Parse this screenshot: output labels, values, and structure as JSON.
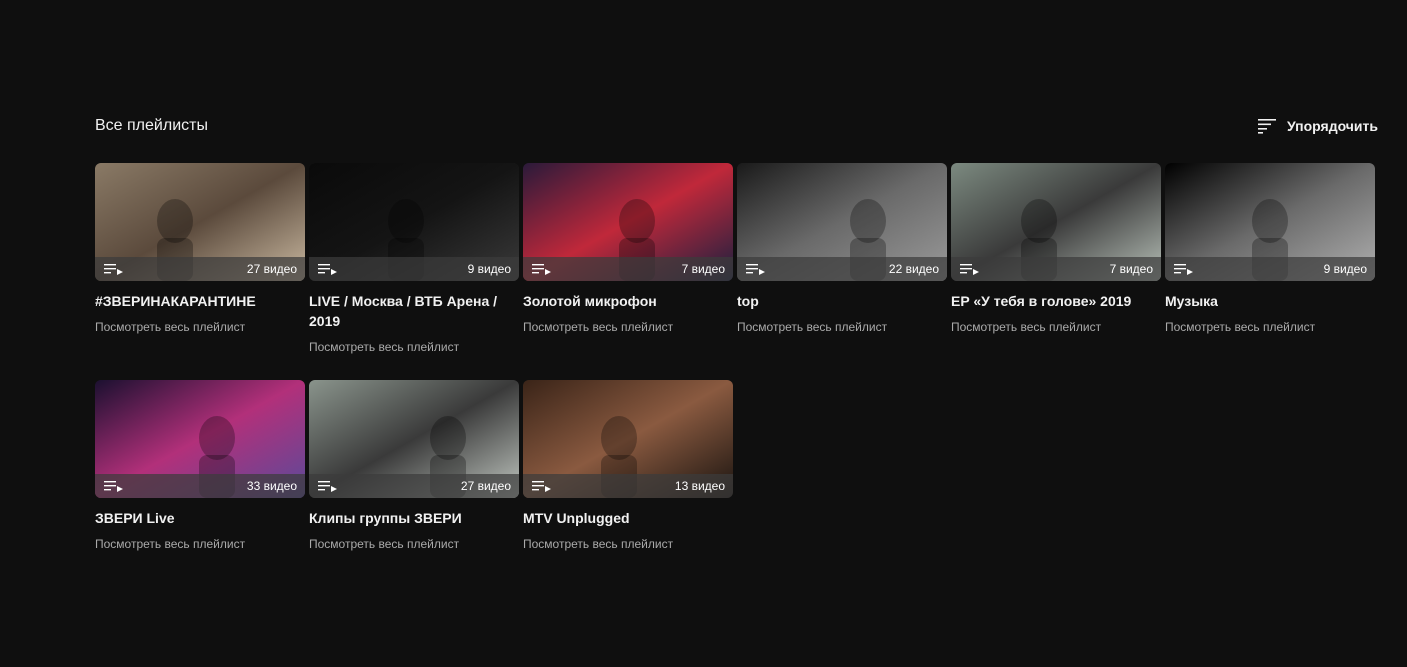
{
  "section": {
    "title": "Все плейлисты",
    "sort_label": "Упорядочить",
    "sort_icon": "sort-icon"
  },
  "playlists": [
    {
      "title": "#ЗВЕРИНАКАРАНТИНЕ",
      "count": "27 видео",
      "link": "Посмотреть весь плейлист",
      "colors": [
        "#8a7a66",
        "#5b4a3c",
        "#c9b8a0"
      ]
    },
    {
      "title": "LIVE / Москва / ВТБ Арена / 2019",
      "count": "9 видео",
      "link": "Посмотреть весь плейлист",
      "colors": [
        "#0a0a0a",
        "#141414",
        "#3a3a3a"
      ]
    },
    {
      "title": "Золотой микрофон",
      "count": "7 видео",
      "link": "Посмотреть весь плейлист",
      "colors": [
        "#2a1a3a",
        "#c0283a",
        "#1a2040"
      ]
    },
    {
      "title": "top",
      "count": "22 видео",
      "link": "Посмотреть весь плейлист",
      "colors": [
        "#1a1a1a",
        "#6a6a6a",
        "#9a9a9a"
      ]
    },
    {
      "title": "EP «У тебя в голове» 2019",
      "count": "7 видео",
      "link": "Посмотреть весь плейлист",
      "colors": [
        "#7c8a80",
        "#3a3a3a",
        "#b7c0b8"
      ]
    },
    {
      "title": "Музыка",
      "count": "9 видео",
      "link": "Посмотреть весь плейлист",
      "colors": [
        "#000000",
        "#6a6a6a",
        "#b0b0b0"
      ]
    },
    {
      "title": "ЗВЕРИ Live",
      "count": "33 видео",
      "link": "Посмотреть весь плейлист",
      "colors": [
        "#1b1030",
        "#b2307a",
        "#5a4a9a"
      ]
    },
    {
      "title": "Клипы группы ЗВЕРИ",
      "count": "27 видео",
      "link": "Посмотреть весь плейлист",
      "colors": [
        "#8a948c",
        "#3a3a3a",
        "#c0c6c0"
      ]
    },
    {
      "title": "MTV Unplugged",
      "count": "13 видео",
      "link": "Посмотреть весь плейлист",
      "colors": [
        "#3a2418",
        "#8a5a40",
        "#1a1410"
      ]
    }
  ]
}
